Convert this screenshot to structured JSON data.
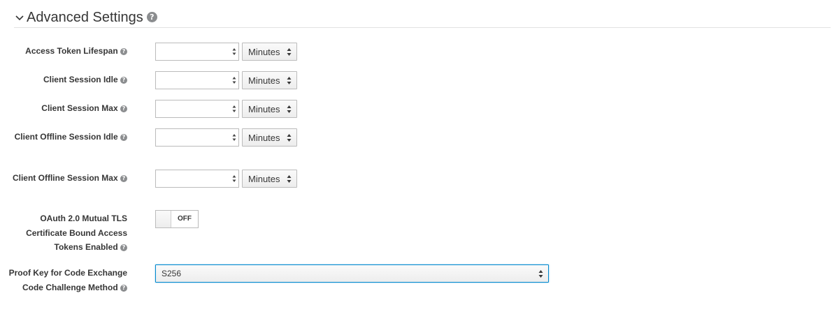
{
  "section": {
    "title": "Advanced Settings",
    "help_icon": "question-circle-icon",
    "collapse_icon": "chevron-down-icon"
  },
  "rows": {
    "access_token_lifespan": {
      "label": "Access Token Lifespan",
      "value": "",
      "unit": "Minutes"
    },
    "client_session_idle": {
      "label": "Client Session Idle",
      "value": "",
      "unit": "Minutes"
    },
    "client_session_max": {
      "label": "Client Session Max",
      "value": "",
      "unit": "Minutes"
    },
    "client_offline_session_idle": {
      "label": "Client Offline Session Idle",
      "value": "",
      "unit": "Minutes"
    },
    "client_offline_session_max": {
      "label": "Client Offline Session Max",
      "value": "",
      "unit": "Minutes"
    }
  },
  "mtls": {
    "label": "OAuth 2.0 Mutual TLS Certificate Bound Access Tokens Enabled",
    "toggle_text": "OFF"
  },
  "pkce": {
    "label": "Proof Key for Code Exchange Code Challenge Method",
    "selected": "S256"
  },
  "help_glyph": "?",
  "colors": {
    "focus_border": "#0088ce",
    "help_icon": "#8b8d8f"
  }
}
